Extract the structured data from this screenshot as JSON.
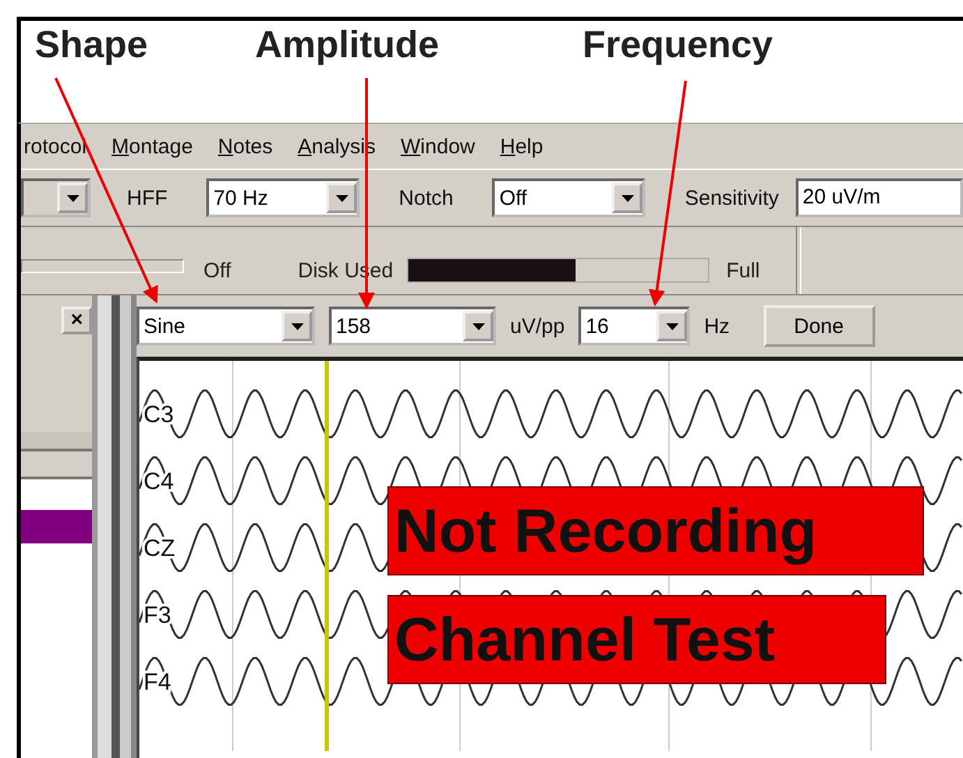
{
  "annotations": [
    {
      "label": "Shape"
    },
    {
      "label": "Amplitude"
    },
    {
      "label": "Frequency"
    }
  ],
  "menu": [
    {
      "label": "rotocol",
      "access_key": false
    },
    {
      "label": "Montage",
      "access_key": true
    },
    {
      "label": "Notes",
      "access_key": true
    },
    {
      "label": "Analysis",
      "access_key": true
    },
    {
      "label": "Window",
      "access_key": true
    },
    {
      "label": "Help",
      "access_key": true
    }
  ],
  "toolbar": [
    {
      "kind": "combo"
    },
    {
      "kind": "label",
      "text": "HFF"
    },
    {
      "kind": "combo",
      "value": "70 Hz"
    },
    {
      "kind": "label",
      "text": "Notch"
    },
    {
      "kind": "combo",
      "value": "Off"
    },
    {
      "kind": "label",
      "text": "Sensitivity"
    },
    {
      "kind": "field",
      "value": "20 uV/m"
    }
  ],
  "status": {
    "record_label": "Off",
    "disk_label": "Disk Used",
    "disk": {
      "level": 0.56
    },
    "full_label": "Full"
  },
  "panel": {
    "close": "×"
  },
  "test_controls": [
    {
      "kind": "combo",
      "value": "Sine"
    },
    {
      "kind": "combo",
      "value": "158"
    },
    {
      "kind": "label",
      "text": "uV/pp"
    },
    {
      "kind": "combo",
      "value": "16"
    },
    {
      "kind": "label",
      "text": "Hz"
    },
    {
      "kind": "button",
      "text": "Done"
    }
  ],
  "channels": [
    {
      "name": "C3"
    },
    {
      "name": "C4"
    },
    {
      "name": "CZ"
    },
    {
      "name": "F3"
    },
    {
      "name": "F4"
    }
  ],
  "overlays": [
    {
      "text": "Not Recording"
    },
    {
      "text": "Channel Test"
    }
  ]
}
